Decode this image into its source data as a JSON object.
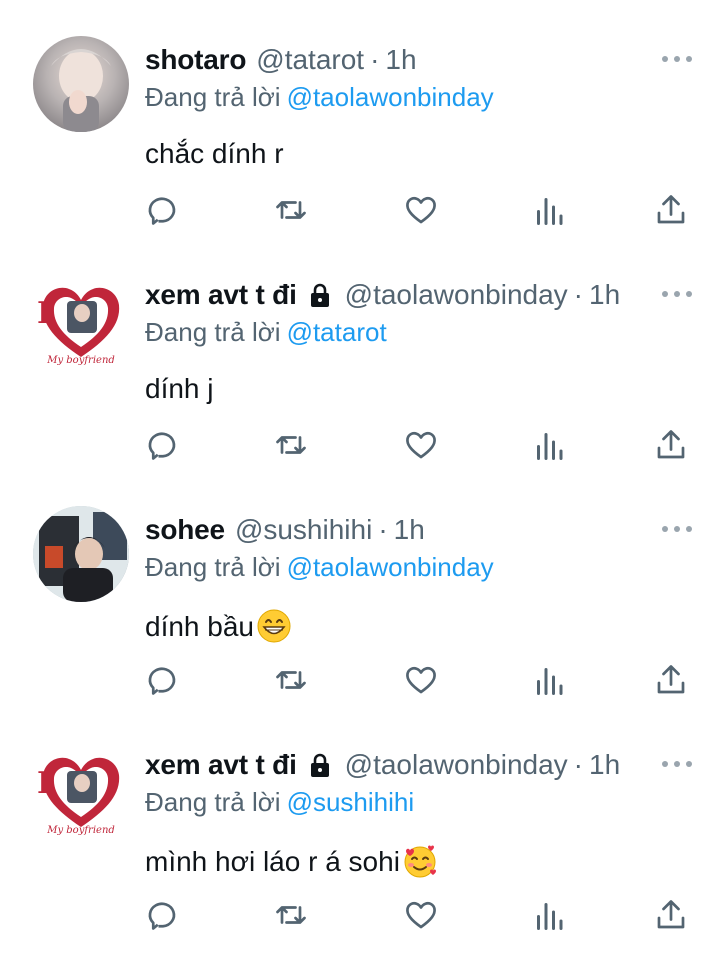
{
  "tweets": [
    {
      "display_name": "shotaro",
      "handle": "@tatarot",
      "dot": "·",
      "time": "1h",
      "replying_prefix": "Đang trả lời",
      "replying_to": "@taolawonbinday",
      "text": "chắc dính r",
      "locked": false,
      "avatar": "photo-avatar"
    },
    {
      "display_name": "xem avt t đi",
      "handle": "@taolawonbinday",
      "dot": "·",
      "time": "1h",
      "replying_prefix": "Đang trả lời",
      "replying_to": "@tatarot",
      "text": "dính j",
      "locked": true,
      "avatar": "heart-logo-avatar",
      "avatar_text": "I My boyfriend"
    },
    {
      "display_name": "sohee",
      "handle": "@sushihihi",
      "dot": "·",
      "time": "1h",
      "replying_prefix": "Đang trả lời",
      "replying_to": "@taolawonbinday",
      "text": "dính bầu",
      "emoji": "grinning-face-emoji",
      "locked": false,
      "avatar": "photo-avatar"
    },
    {
      "display_name": "xem avt t đi",
      "handle": "@taolawonbinday",
      "dot": "·",
      "time": "1h",
      "replying_prefix": "Đang trả lời",
      "replying_to": "@sushihihi",
      "text": "mình hơi láo r á sohi",
      "emoji": "smiling-face-with-hearts-emoji",
      "locked": true,
      "avatar": "heart-logo-avatar",
      "avatar_text": "I My boyfriend"
    }
  ],
  "colors": {
    "text_primary": "#0f1419",
    "text_secondary": "#536471",
    "mention": "#1d9bf0",
    "heart_logo": "#c0263a"
  },
  "action_icons": [
    "reply-icon",
    "retweet-icon",
    "like-icon",
    "views-icon",
    "share-icon"
  ]
}
